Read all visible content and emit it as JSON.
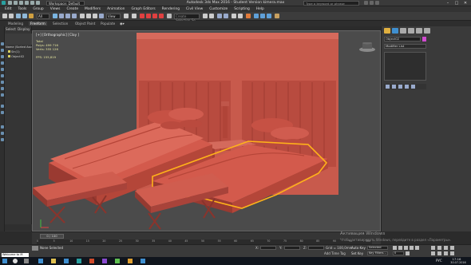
{
  "window": {
    "title": "Autodesk 3ds Max 2016 - Student Version   kimera.max",
    "workspace": "Workspace: Default",
    "search_placeholder": "Type a keyword or phrase"
  },
  "menu": [
    "Edit",
    "Tools",
    "Group",
    "Views",
    "Create",
    "Modifiers",
    "Animation",
    "Graph Editors",
    "Rendering",
    "Civil View",
    "Customize",
    "Scripting",
    "Help"
  ],
  "toolbar": {
    "filter_value": "All",
    "view_value": "View",
    "selection_set_placeholder": "Create Selection Se"
  },
  "ribbon_tabs": [
    {
      "label": "Modeling",
      "active": false
    },
    {
      "label": "Freeform",
      "active": true
    },
    {
      "label": "Selection",
      "active": false
    },
    {
      "label": "Object Paint",
      "active": false
    },
    {
      "label": "Populate",
      "active": false
    }
  ],
  "explorer": {
    "tabs": [
      "Select",
      "Display"
    ],
    "rows": [
      "Name (Sorted Ascen...",
      "Sin(1)",
      "Object02"
    ]
  },
  "viewport": {
    "label": "[+] [Orthographic] [Clay ]",
    "stats": [
      {
        "label": "Total",
        "value": ""
      },
      {
        "label": "Polys:",
        "value": "499 716"
      },
      {
        "label": "Verts:",
        "value": "355 126"
      },
      {
        "label": "FPS:",
        "value": "155,819"
      }
    ]
  },
  "command_panel": {
    "object_name": "Object02",
    "modifier_list": "Modifier List"
  },
  "timeline": {
    "frame": "0 / 100",
    "ticks": [
      "0",
      "5",
      "10",
      "15",
      "20",
      "25",
      "30",
      "35",
      "40",
      "45",
      "50",
      "55",
      "60",
      "65",
      "70",
      "75",
      "80",
      "85",
      "90",
      "95",
      "100"
    ]
  },
  "status": {
    "selected": "None Selected",
    "x_label": "X:",
    "y_label": "Y:",
    "z_label": "Z:",
    "grid": "Grid = 100,0mm",
    "add_time_tag": "Add Time Tag",
    "autokey_label": "Auto Key",
    "autokey_value": "Selected",
    "setkey_label": "Set Key",
    "key_filters": "Key Filters...",
    "frame_value": "0",
    "maxscript": "Welcome to M"
  },
  "watermark": {
    "line1": "Активация Windows",
    "line2": "Чтобы активировать Windows, перейдите в раздел «Параметры»."
  },
  "taskbar": {
    "lang": "РУС",
    "time": "17:16",
    "date": "30.07.2016"
  },
  "colors": {
    "bed": "#cf4f43",
    "selection": "#ffb21a",
    "viewport_bg": "#4b4b4b",
    "accent": "#3f8fd0"
  }
}
